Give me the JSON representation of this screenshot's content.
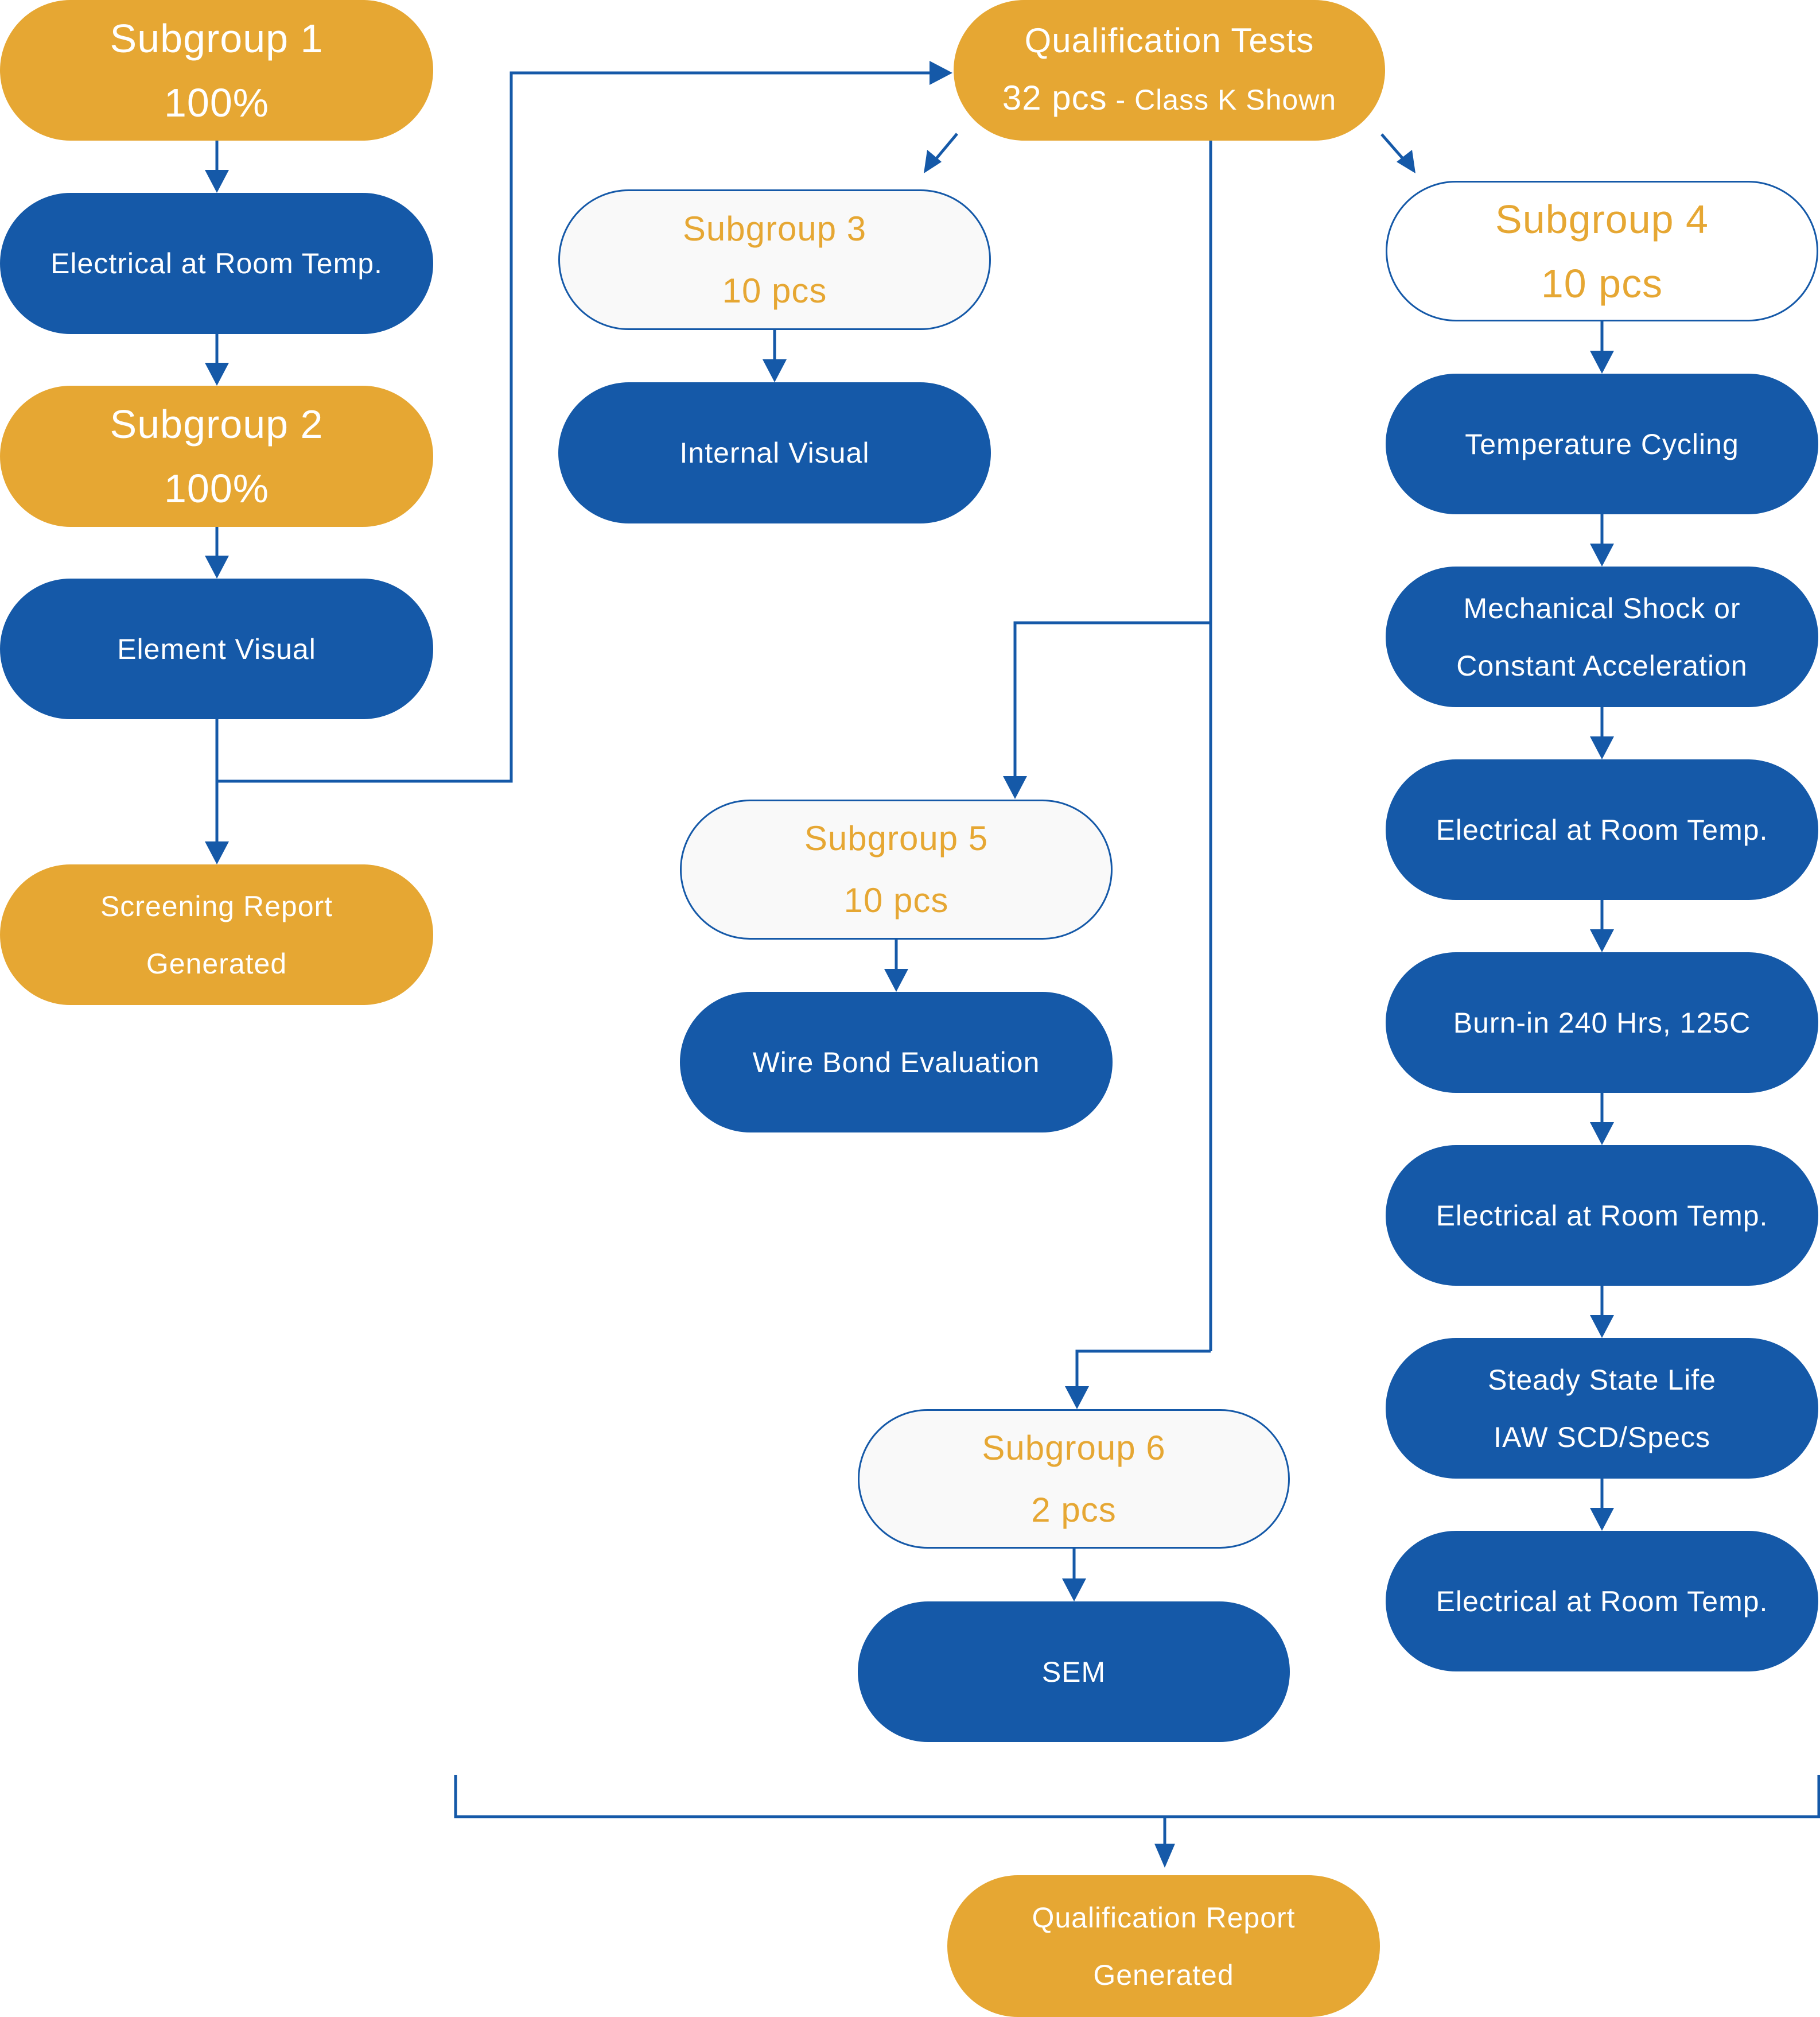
{
  "colors": {
    "gold": "#E6A733",
    "blue": "#1559A8",
    "outline_fill": "#F9F9F9",
    "text_white": "#FFFFFF"
  },
  "screening": {
    "subgroup1": {
      "title": "Subgroup 1",
      "qty": "100%"
    },
    "electrical": {
      "label": "Electrical at Room Temp."
    },
    "subgroup2": {
      "title": "Subgroup 2",
      "qty": "100%"
    },
    "element_visual": {
      "label": "Element Visual"
    },
    "report": {
      "line1": "Screening Report",
      "line2": "Generated"
    }
  },
  "qualification": {
    "title": "Qualification Tests",
    "qty": "32 pcs",
    "qty_note": " - Class K Shown"
  },
  "subgroup3": {
    "title": "Subgroup 3",
    "qty": "10 pcs",
    "steps": [
      "Internal Visual"
    ]
  },
  "subgroup4": {
    "title": "Subgroup 4",
    "qty": "10 pcs",
    "steps": [
      {
        "line1": "Temperature Cycling"
      },
      {
        "line1": "Mechanical Shock or",
        "line2": "Constant Acceleration"
      },
      {
        "line1": "Electrical at Room Temp."
      },
      {
        "line1": "Burn-in 240 Hrs, 125C"
      },
      {
        "line1": "Electrical at Room Temp."
      },
      {
        "line1": "Steady State Life",
        "line2": "IAW SCD/Specs"
      },
      {
        "line1": "Electrical at Room Temp."
      }
    ]
  },
  "subgroup5": {
    "title": "Subgroup 5",
    "qty": "10 pcs",
    "steps": [
      "Wire Bond Evaluation"
    ]
  },
  "subgroup6": {
    "title": "Subgroup 6",
    "qty": "2 pcs",
    "steps": [
      "SEM"
    ]
  },
  "final_report": {
    "line1": "Qualification Report",
    "line2": "Generated"
  }
}
